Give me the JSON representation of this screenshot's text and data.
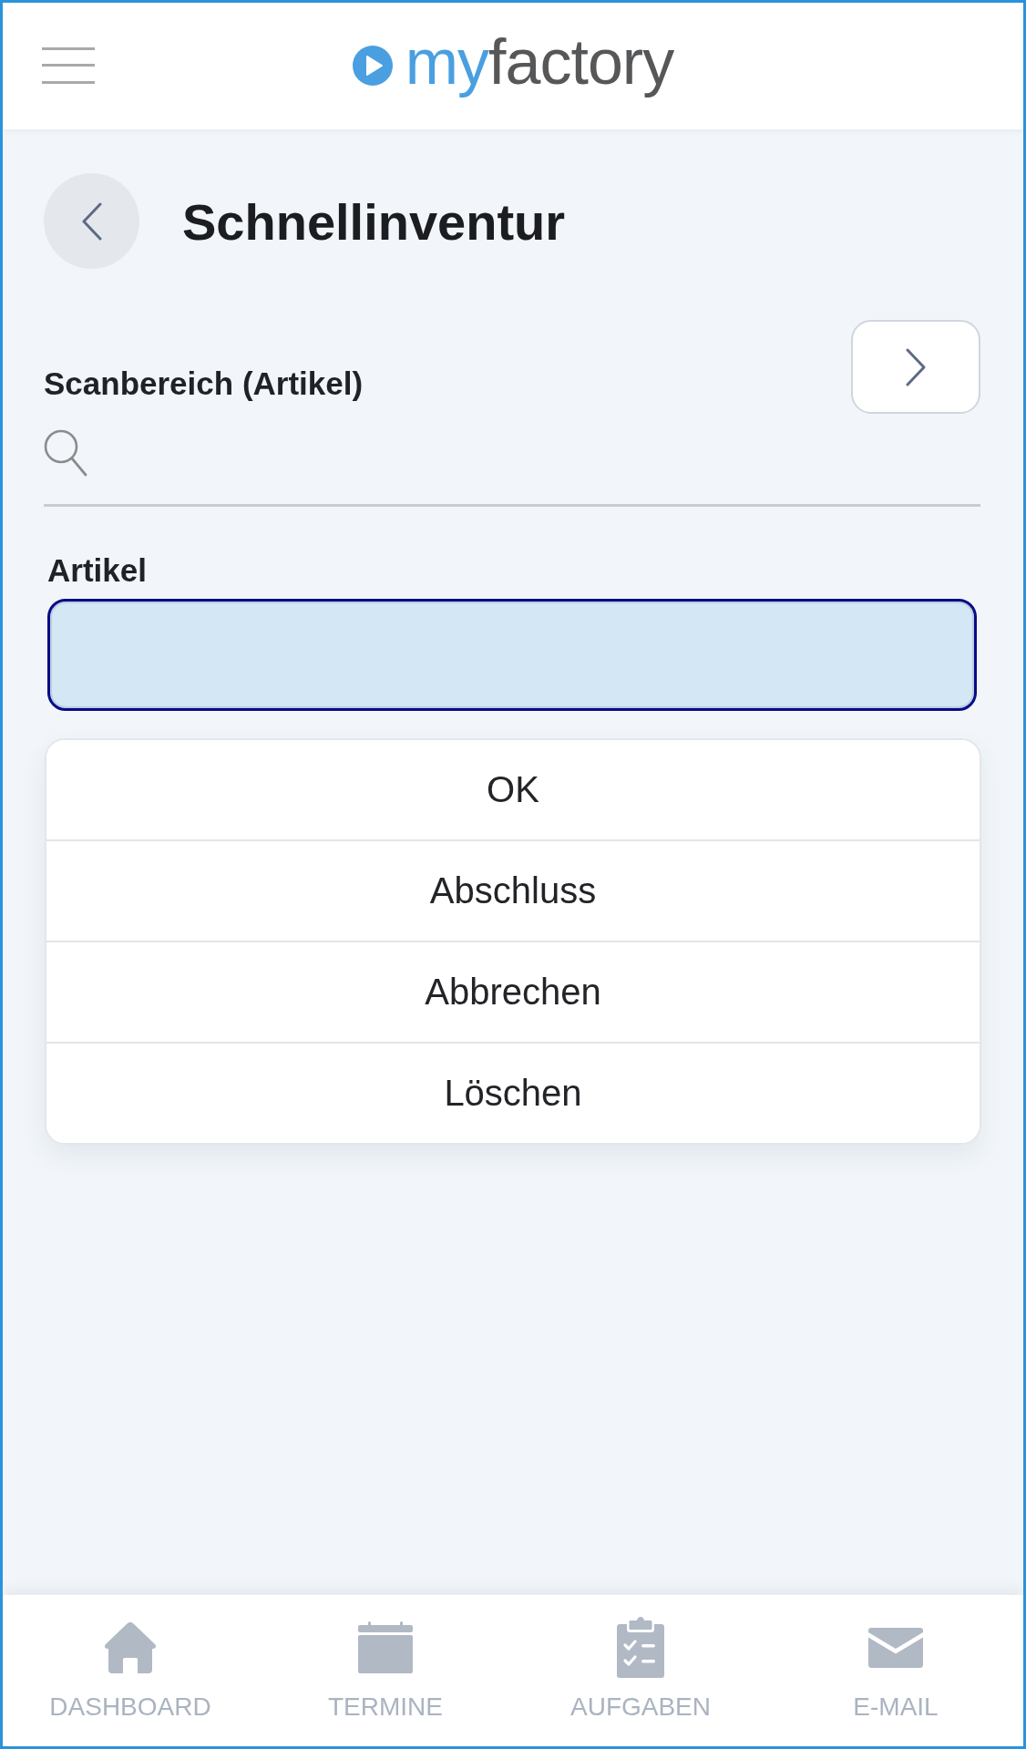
{
  "header": {
    "logo": {
      "accent": "my",
      "rest": "factory"
    }
  },
  "page": {
    "title": "Schnellinventur"
  },
  "scan_field": {
    "label": "Scanbereich (Artikel)"
  },
  "article_field": {
    "label": "Artikel",
    "focused": true
  },
  "actions": [
    "OK",
    "Abschluss",
    "Abbrechen",
    "Löschen"
  ],
  "bottom_nav": [
    {
      "label": "DASHBOARD",
      "kind": "home",
      "selected": false
    },
    {
      "label": "TERMINE",
      "kind": "calendar",
      "selected": false
    },
    {
      "label": "AUFGABEN",
      "kind": "tasks",
      "selected": false
    },
    {
      "label": "E-MAIL",
      "kind": "mail",
      "selected": false
    }
  ]
}
